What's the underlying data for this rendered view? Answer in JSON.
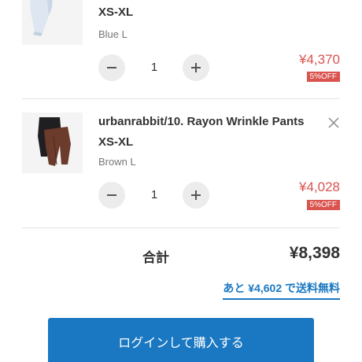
{
  "items": [
    {
      "name_line2": "XS-XL",
      "variant": "Blue L",
      "quantity": "1",
      "price": "¥4,370",
      "discount": "5%OFF",
      "image_icon": "shirt-photo"
    },
    {
      "name_line1": "urbanrabbit/10. Rayon Wrinkle Pants",
      "name_line2": "XS-XL",
      "variant": "Brown L",
      "quantity": "1",
      "price": "¥4,028",
      "discount": "5%OFF",
      "image_icon": "pants-photo"
    }
  ],
  "summary": {
    "total_label": "合計",
    "total_value": "¥8,398",
    "free_shipping_text": "あと ¥4,602 で送料無料"
  },
  "checkout_button": "ログインして購入する",
  "colors": {
    "accent": "#1a78c2",
    "price": "#d9534f"
  }
}
